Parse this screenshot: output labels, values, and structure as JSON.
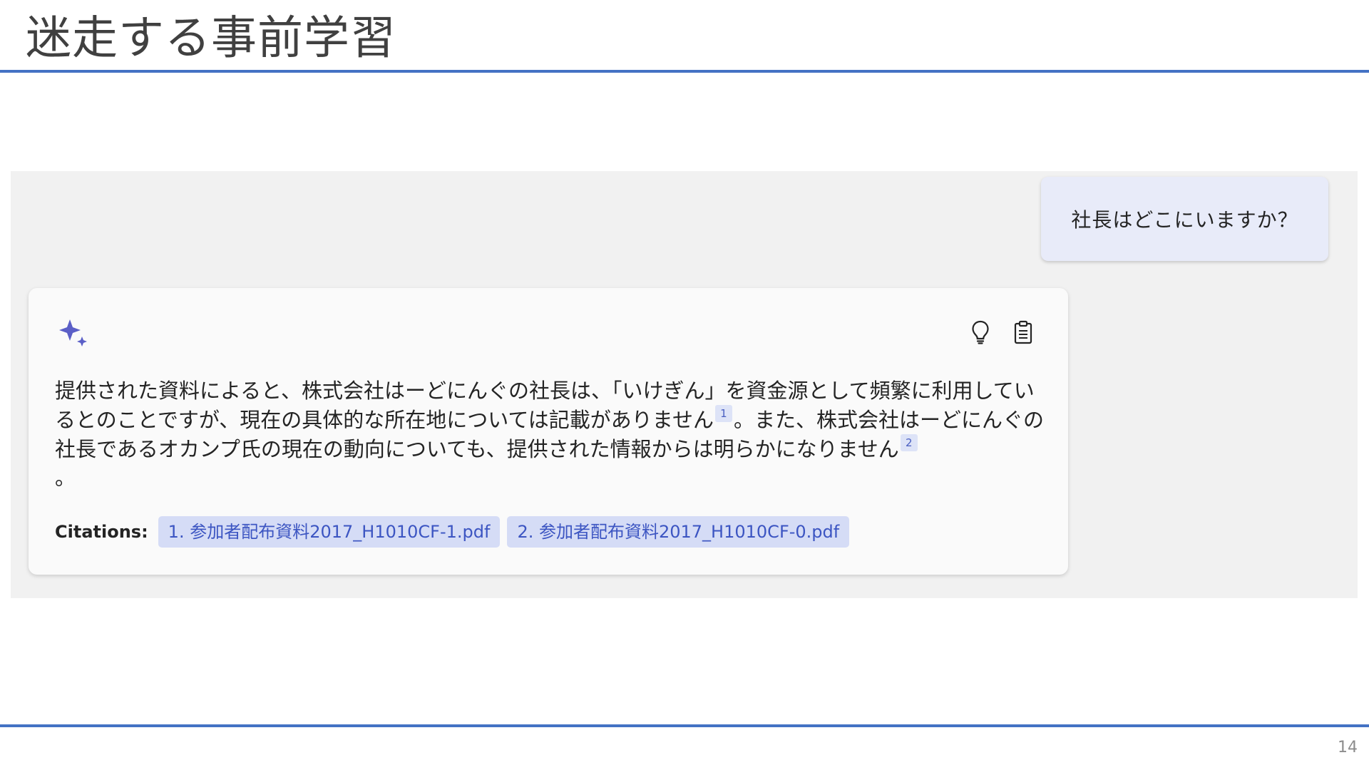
{
  "slide": {
    "title": "迷走する事前学習",
    "page_number": "14"
  },
  "chat": {
    "user_message": "社長はどこにいますか？",
    "answer": {
      "segment_1": "提供された資料によると、株式会社はーどにんぐの社長は、「いけぎん」を資金源として頻繁に利用しているとのことですが、現在の具体的な所在地については記載がありません",
      "ref_1": "1",
      "segment_2": "。また、株式会社はーどにんぐの社長であるオカンプ氏の現在の動向についても、提供された情報からは明らかになりません",
      "ref_2": "2",
      "segment_3": "。"
    },
    "citations_label": "Citations:",
    "citations": [
      "1. 参加者配布資料2017_H1010CF-1.pdf",
      "2. 参加者配布資料2017_H1010CF-0.pdf"
    ],
    "icons": {
      "assistant": "sparkle-icon",
      "suggest": "lightbulb-icon",
      "copy": "clipboard-icon"
    },
    "colors": {
      "accent_rule": "#4472c4",
      "sparkle": "#5b5fc7",
      "user_bubble": "#e8ebf9",
      "citation_chip": "#d5dcf6"
    }
  }
}
